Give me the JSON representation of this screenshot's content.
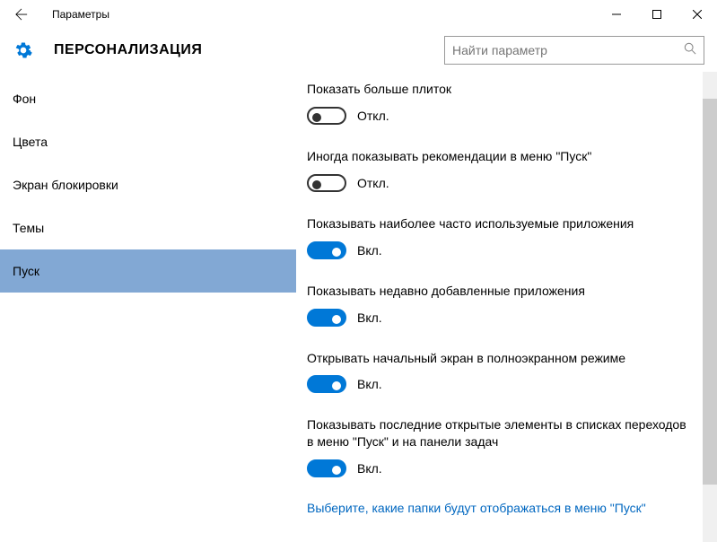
{
  "window": {
    "title": "Параметры"
  },
  "page": {
    "title": "ПЕРСОНАЛИЗАЦИЯ"
  },
  "search": {
    "placeholder": "Найти параметр"
  },
  "sidebar": {
    "items": [
      {
        "label": "Фон",
        "selected": false
      },
      {
        "label": "Цвета",
        "selected": false
      },
      {
        "label": "Экран блокировки",
        "selected": false
      },
      {
        "label": "Темы",
        "selected": false
      },
      {
        "label": "Пуск",
        "selected": true
      }
    ]
  },
  "settings": [
    {
      "label": "Показать больше плиток",
      "on": false,
      "state": "Откл."
    },
    {
      "label": "Иногда показывать рекомендации в меню \"Пуск\"",
      "on": false,
      "state": "Откл."
    },
    {
      "label": "Показывать наиболее часто используемые приложения",
      "on": true,
      "state": "Вкл."
    },
    {
      "label": "Показывать недавно добавленные приложения",
      "on": true,
      "state": "Вкл."
    },
    {
      "label": "Открывать начальный экран в полноэкранном режиме",
      "on": true,
      "state": "Вкл."
    },
    {
      "label": "Показывать последние открытые элементы в списках переходов в меню \"Пуск\" и на панели задач",
      "on": true,
      "state": "Вкл."
    }
  ],
  "link": {
    "label": "Выберите, какие папки будут отображаться в меню \"Пуск\""
  }
}
